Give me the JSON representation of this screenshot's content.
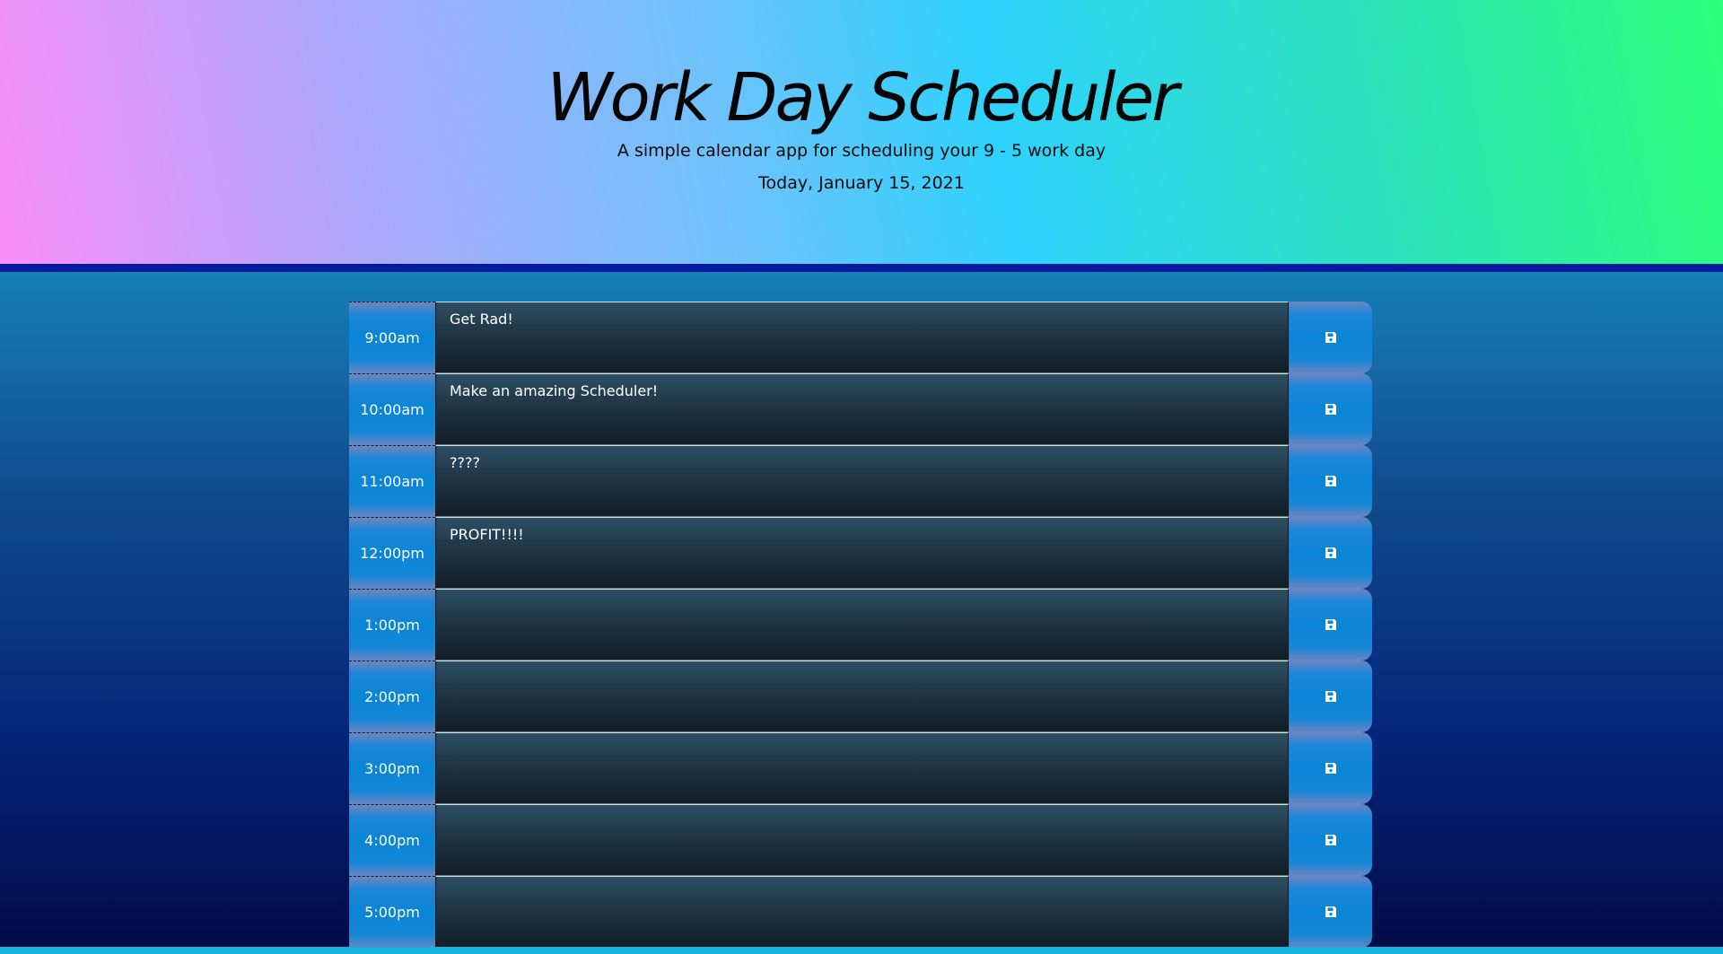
{
  "header": {
    "title": "Work Day Scheduler",
    "subtitle": "A simple calendar app for scheduling your 9 - 5 work day",
    "date": "Today, January 15, 2021"
  },
  "schedule": {
    "rows": [
      {
        "hour": "9:00am",
        "text": "Get Rad!"
      },
      {
        "hour": "10:00am",
        "text": "Make an amazing Scheduler!"
      },
      {
        "hour": "11:00am",
        "text": "????"
      },
      {
        "hour": "12:00pm",
        "text": "PROFIT!!!!"
      },
      {
        "hour": "1:00pm",
        "text": ""
      },
      {
        "hour": "2:00pm",
        "text": ""
      },
      {
        "hour": "3:00pm",
        "text": ""
      },
      {
        "hour": "4:00pm",
        "text": ""
      },
      {
        "hour": "5:00pm",
        "text": ""
      }
    ],
    "save_icon": "floppy-disk-icon"
  },
  "colors": {
    "header_gradient": [
      "#f98ef9",
      "#2dd2fc",
      "#2dfd79"
    ],
    "divider": "#031a9c",
    "hour_block": "#0a85d6",
    "entry_block": "#1f3545",
    "page_background_top": "#1680b9",
    "page_background_bottom": "#030a45"
  }
}
